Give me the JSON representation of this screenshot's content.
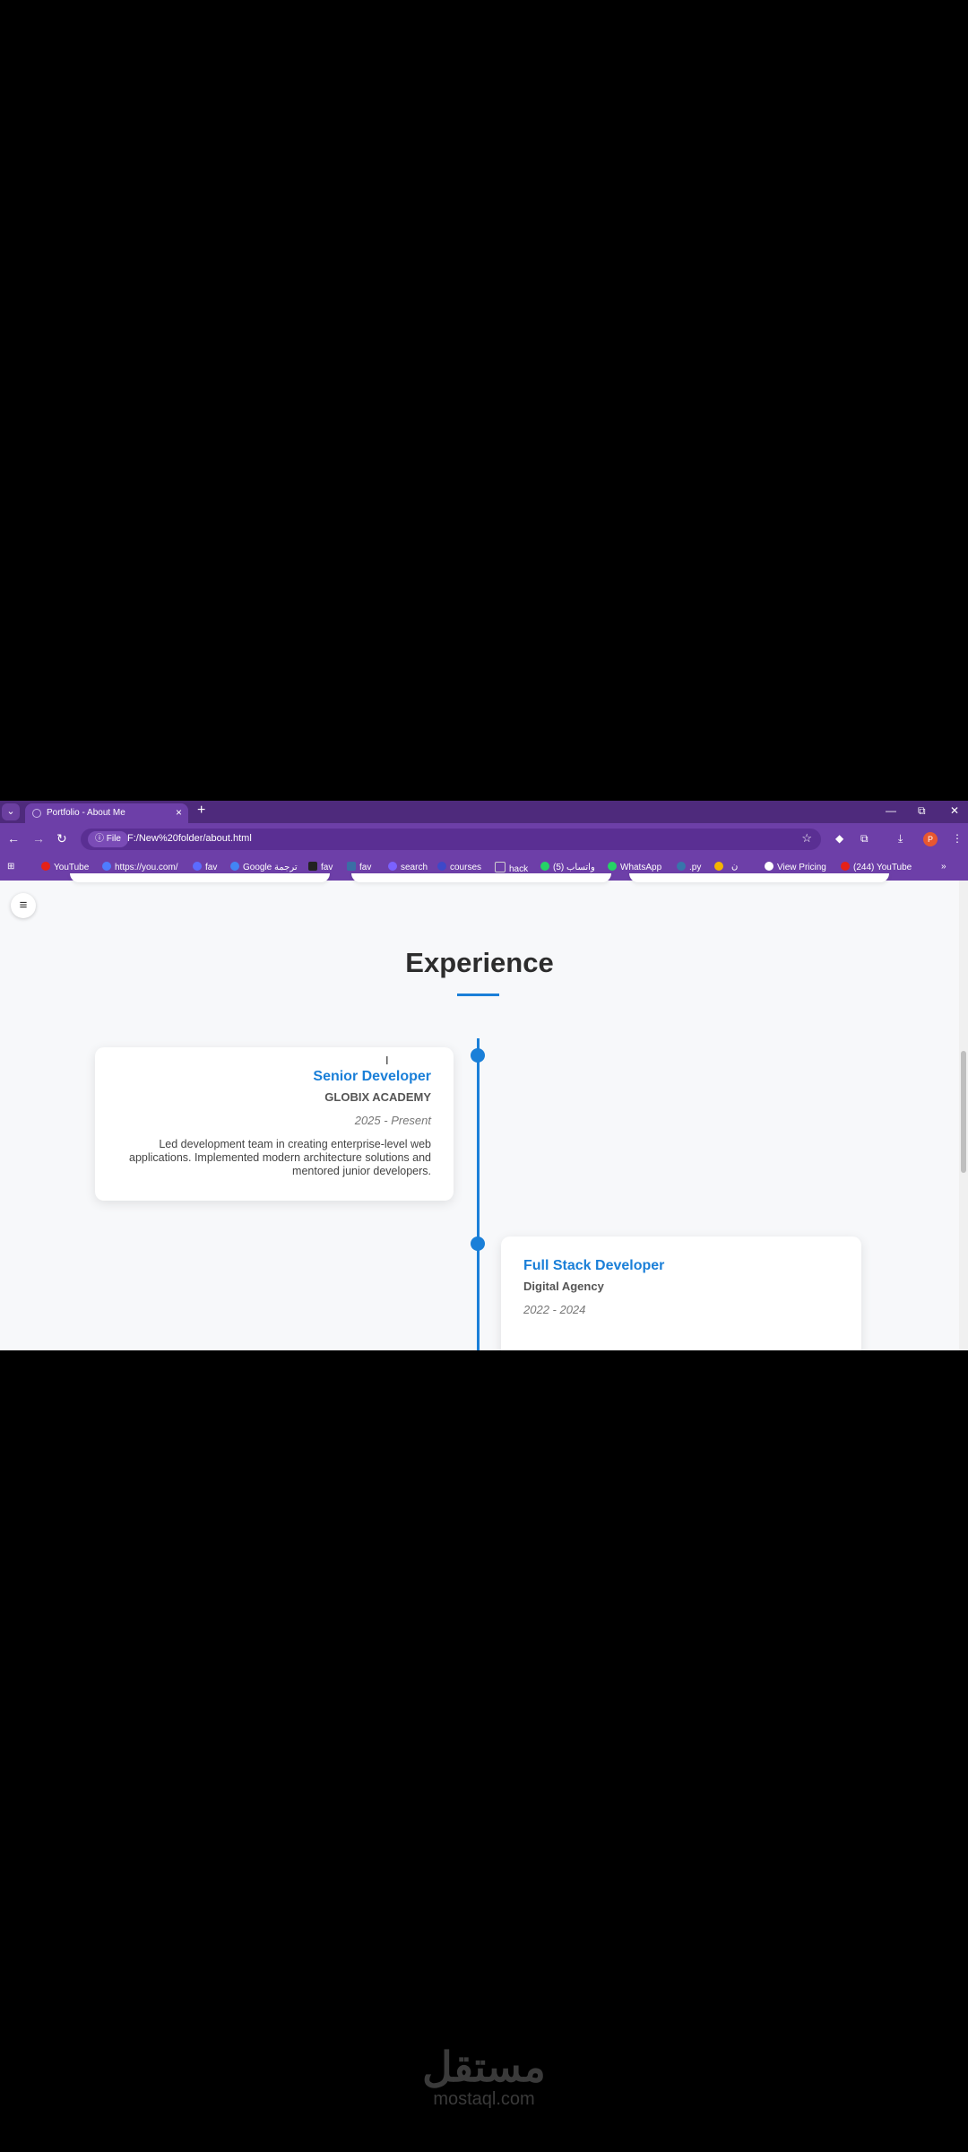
{
  "browser": {
    "tab_title": "Portfolio - About Me",
    "new_tab": "+",
    "tab_close": "×",
    "window_controls": [
      "—",
      "⧉",
      "✕"
    ],
    "omnibox": {
      "scheme_chip": "ⓘ File",
      "url": "F:/New%20folder/about.html"
    },
    "bookmarks": [
      {
        "label": "YouTube",
        "color": "#e62117"
      },
      {
        "label": "https://you.com/",
        "color": "#4e7cff"
      },
      {
        "label": "fav",
        "color": "#5b6bff"
      },
      {
        "label": "Google ترجمة",
        "color": "#4285f4"
      },
      {
        "label": "fav",
        "color": "#222222"
      },
      {
        "label": "fav",
        "color": "#3a6ea5"
      },
      {
        "label": "search",
        "color": "#7b61ff"
      },
      {
        "label": "courses",
        "color": "#3e48c9"
      },
      {
        "label": "hack",
        "color": "#cfcfcf"
      },
      {
        "label": "(5) واتساب",
        "color": "#25d366"
      },
      {
        "label": "WhatsApp",
        "color": "#25d366"
      },
      {
        "label": ".py",
        "color": "#3776ab"
      },
      {
        "label": "",
        "color": "#f4b400"
      },
      {
        "label": "ن",
        "color": "#ffffff"
      },
      {
        "label": "View Pricing",
        "color": "#ffffff"
      },
      {
        "label": "(244) YouTube",
        "color": "#e62117"
      }
    ],
    "bookmarks_overflow": "»"
  },
  "page": {
    "menu_icon": "≡",
    "section_title": "Experience",
    "experience": [
      {
        "role": "Senior Developer",
        "company": "GLOBIX ACADEMY",
        "period": "2025 - Present",
        "description": "Led development team in creating enterprise-level web applications. Implemented modern architecture solutions and mentored junior developers."
      },
      {
        "role": "Full Stack Developer",
        "company": "Digital Agency",
        "period": "2022 - 2024"
      }
    ]
  },
  "watermark": {
    "arabic": "مستقل",
    "latin": "mostaql.com"
  },
  "colors": {
    "accent": "#1a7fd8",
    "browser_chrome": "#6d3fa8",
    "tab_strip": "#4e2a7c"
  }
}
